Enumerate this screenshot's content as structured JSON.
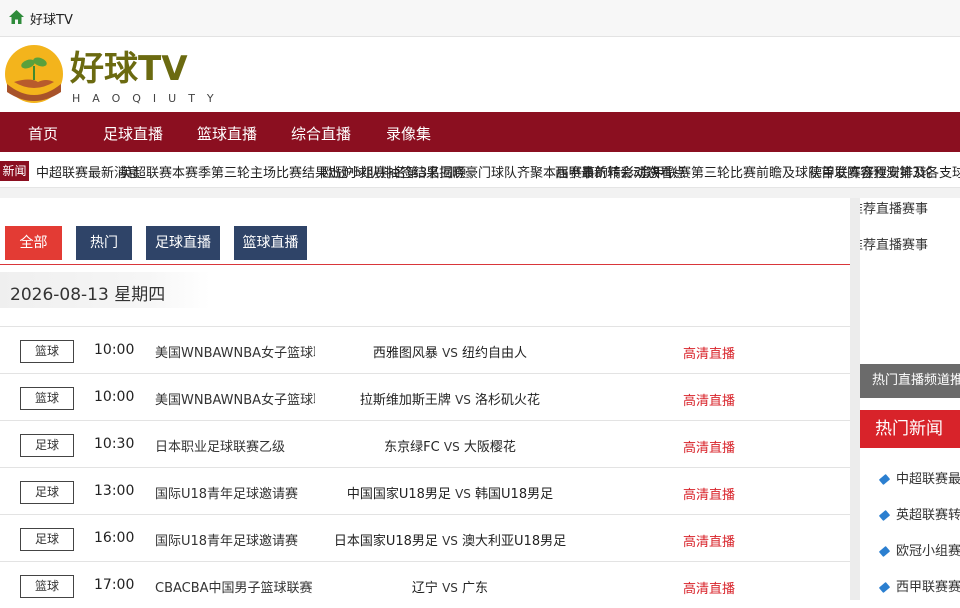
{
  "topbar": {
    "site_name": "好球TV"
  },
  "logo": {
    "text": "好球TV",
    "subtext": "HAOQIUTY"
  },
  "nav": {
    "items": [
      "首页",
      "足球直播",
      "篮球直播",
      "综合直播",
      "录像集"
    ]
  },
  "ticker": {
    "tag": "新闻",
    "items": [
      "中超联赛最新消息",
      "英超联赛本赛季第三轮主场比赛结果出炉球队排名第3名回顾",
      "欧冠小组赛抽签结果揭晓豪门球队齐聚本届赛事的精彩对决看点",
      "西甲最新转会动态",
      "意甲联赛第三轮比赛前瞻及球队首发阵容预测第3轮",
      "德甲联赛赛程安排及各支球队近期状态分析汇总报道最新"
    ]
  },
  "tabs": [
    "全部",
    "热门",
    "足球直播",
    "篮球直播"
  ],
  "date_header": "2026-08-13 星期四",
  "matches": [
    {
      "type": "篮球",
      "time": "10:00",
      "league": "美国WNBAWNBA女子篮球联赛",
      "home": "西雅图风暴",
      "away": "纽约自由人",
      "action": "高清直播"
    },
    {
      "type": "篮球",
      "time": "10:00",
      "league": "美国WNBAWNBA女子篮球联赛",
      "home": "拉斯维加斯王牌",
      "away": "洛杉矶火花",
      "action": "高清直播"
    },
    {
      "type": "足球",
      "time": "10:30",
      "league": "日本职业足球联赛乙级",
      "home": "东京绿FC",
      "away": "大阪樱花",
      "action": "高清直播"
    },
    {
      "type": "足球",
      "time": "13:00",
      "league": "国际U18青年足球邀请赛",
      "home": "中国国家U18男足",
      "away": "韩国U18男足",
      "action": "高清直播"
    },
    {
      "type": "足球",
      "time": "16:00",
      "league": "国际U18青年足球邀请赛",
      "home": "日本国家U18男足",
      "away": "澳大利亚U18男足",
      "action": "高清直播"
    },
    {
      "type": "篮球",
      "time": "17:00",
      "league": "CBACBA中国男子篮球联赛",
      "home": "辽宁",
      "away": "广东",
      "action": "高清直播"
    }
  ],
  "vs_text": "VS",
  "right": {
    "top_lines": [
      "推荐直播赛事",
      "推荐直播赛事"
    ],
    "gray_bar": "热门直播频道推荐列表更新",
    "red_bar": "热门新闻",
    "items": [
      "中超联赛最新消息报道",
      "英超联赛转会最新动态",
      "欧冠小组赛前瞻分析",
      "西甲联赛赛程安排"
    ]
  },
  "colors": {
    "brand": "#8b0f20",
    "accent": "#d8232a",
    "tab_dark": "#2f4468",
    "tab_active": "#e33b34"
  }
}
